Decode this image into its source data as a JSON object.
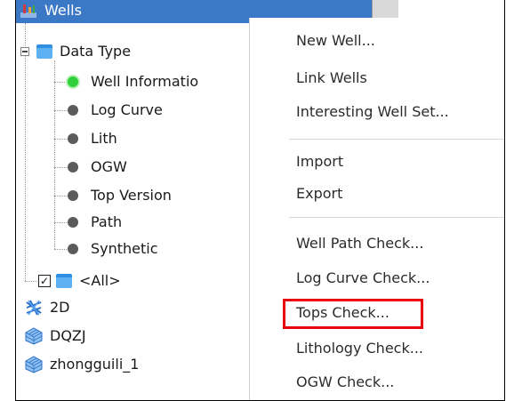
{
  "tree": {
    "root": {
      "label": "Wells"
    },
    "data_type": {
      "label": "Data Type"
    },
    "items": [
      {
        "label": "Well Informatio",
        "status": "active"
      },
      {
        "label": "Log Curve"
      },
      {
        "label": "Lith"
      },
      {
        "label": "OGW"
      },
      {
        "label": "Top Version"
      },
      {
        "label": "Path"
      },
      {
        "label": "Synthetic"
      }
    ],
    "all": {
      "label": "<All>",
      "checked_glyph": "✓"
    },
    "projects": [
      {
        "label": "2D",
        "icon": "seismic-2d-icon"
      },
      {
        "label": "DQZJ",
        "icon": "survey-3d-icon"
      },
      {
        "label": "zhongguili_1",
        "icon": "survey-3d-icon"
      }
    ]
  },
  "context_menu": {
    "items": [
      "New Well...",
      "Link Wells",
      "Interesting Well Set...",
      "Import",
      "Export",
      "Well Path Check...",
      "Log Curve Check...",
      "Tops Check...",
      "Lithology Check...",
      "OGW Check..."
    ],
    "highlighted": "Tops Check..."
  },
  "colors": {
    "selection": "#3b78c5",
    "highlight_border": "#e8000b",
    "active_dot": "#2fd03a"
  }
}
